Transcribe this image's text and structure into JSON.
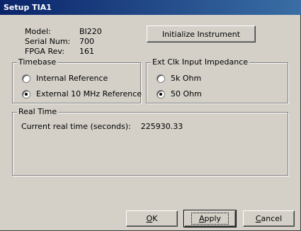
{
  "window": {
    "title": "Setup TIA1"
  },
  "info": {
    "model_label": "Model:",
    "model_value": "BI220",
    "serial_label": "Serial Num:",
    "serial_value": "700",
    "fpga_label": "FPGA Rev:",
    "fpga_value": "161"
  },
  "initialize_button": "Initialize Instrument",
  "timebase": {
    "title": "Timebase",
    "options": [
      {
        "label": "Internal Reference",
        "checked": false
      },
      {
        "label": "External 10 MHz Reference",
        "checked": true
      }
    ]
  },
  "ext_clk": {
    "title": "Ext Clk Input Impedance",
    "options": [
      {
        "label": "5k Ohm",
        "checked": false
      },
      {
        "label": "50 Ohm",
        "checked": true
      }
    ]
  },
  "realtime": {
    "title": "Real Time",
    "label": "Current real time (seconds):",
    "value": "225930.33"
  },
  "buttons": {
    "ok": {
      "label": "OK",
      "mnemonic": "O"
    },
    "apply": {
      "label": "Apply",
      "mnemonic": "A"
    },
    "cancel": {
      "label": "Cancel",
      "mnemonic": "C"
    }
  }
}
